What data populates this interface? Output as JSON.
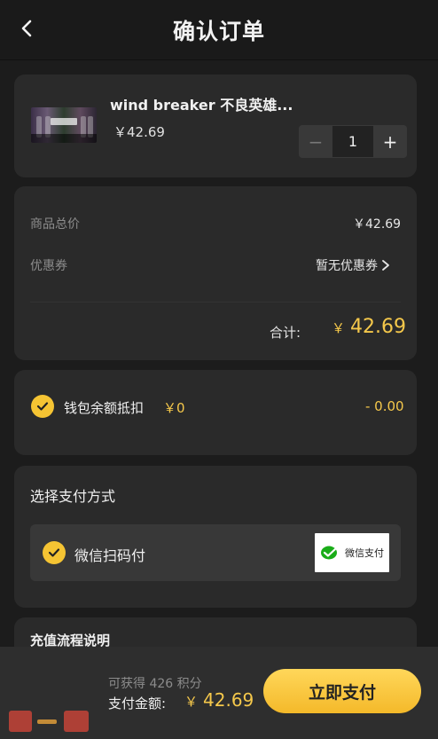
{
  "header": {
    "title": "确认订单"
  },
  "product": {
    "name": "wind breaker 不良英雄...",
    "price": "￥42.69",
    "quantity": "1",
    "minus_symbol": "−",
    "plus_symbol": "+"
  },
  "summary": {
    "subtotal_label": "商品总价",
    "subtotal_value": "￥42.69",
    "coupon_label": "优惠券",
    "coupon_value": "暂无优惠券",
    "total_label": "合计:",
    "total_currency": "￥",
    "total_value": "42.69"
  },
  "wallet": {
    "label": "钱包余额抵扣",
    "amount": "￥0",
    "deduction": "- 0.00",
    "checked": true
  },
  "payment": {
    "section_title": "选择支付方式",
    "method_label": "微信扫码付",
    "badge_text": "微信支付",
    "checked": true
  },
  "recharge": {
    "title": "充值流程说明"
  },
  "footer": {
    "points_text": "可获得 426 积分",
    "pay_label": "支付金额:",
    "pay_currency": "￥",
    "pay_value": "42.69",
    "pay_button": "立即支付"
  },
  "colors": {
    "accent": "#f5c84b",
    "background": "#1c1c1c",
    "card": "#2a2a2a",
    "button": "#f4b92a",
    "wechat_green": "#1aad19"
  },
  "icons": {
    "back": "chevron-left-icon",
    "check": "check-icon",
    "coupon_arrow": "chevron-right-icon",
    "wechat": "wechat-pay-icon"
  }
}
